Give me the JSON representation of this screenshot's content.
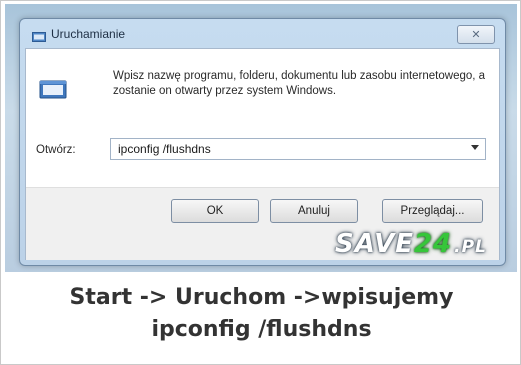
{
  "dialog": {
    "title": "Uruchamianie",
    "close_glyph": "✕",
    "description": "Wpisz nazwę programu, folderu, dokumentu lub zasobu internetowego, a zostanie on otwarty przez system Windows.",
    "open_label": "Otwórz:",
    "command_value": "ipconfig /flushdns",
    "buttons": {
      "ok": "OK",
      "cancel": "Anuluj",
      "browse": "Przeglądaj..."
    },
    "icons": {
      "title": "run-dialog-icon",
      "main": "run-program-icon",
      "dropdown": "chevron-down-icon"
    }
  },
  "watermark": {
    "prefix": "SAVE",
    "number": "24",
    "tld": ".PL"
  },
  "caption": {
    "line1": "Start -> Uruchom ->wpisujemy",
    "line2": "ipconfig /flushdns"
  },
  "colors": {
    "titlebar": "#c6dcf0",
    "watermark_accent": "#36c63a",
    "caption_text": "#333333"
  }
}
